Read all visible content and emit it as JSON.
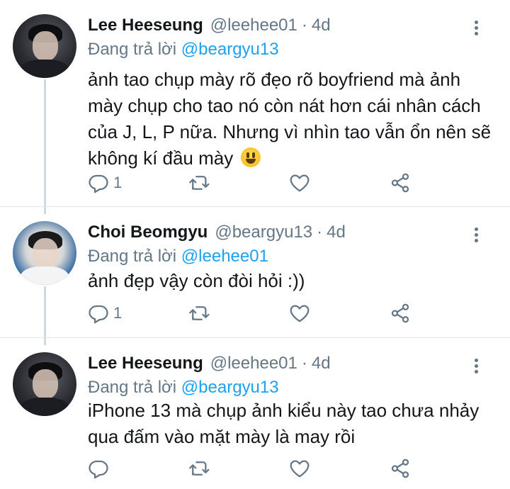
{
  "tweets": [
    {
      "name": "Lee Heeseung",
      "handle": "@leehee01",
      "separator": "·",
      "time": "4d",
      "reply_prefix": "Đang trả lời ",
      "reply_to": "@beargyu13",
      "text": "ảnh tao chụp mày rõ đẹo rõ boyfriend mà ảnh mày chụp cho tao nó còn nát hơn cái nhân cách của J, L, P nữa. Nhưng vì nhìn tao vẫn ổn nên sẽ không kí đầu mày",
      "emoji": "grinning-face-icon",
      "reply_count": "1"
    },
    {
      "name": "Choi Beomgyu",
      "handle": "@beargyu13",
      "separator": "·",
      "time": "4d",
      "reply_prefix": "Đang trả lời ",
      "reply_to": "@leehee01",
      "text": "ảnh đẹp vậy còn đòi hỏi :))",
      "reply_count": "1"
    },
    {
      "name": "Lee Heeseung",
      "handle": "@leehee01",
      "separator": "·",
      "time": "4d",
      "reply_prefix": "Đang trả lời ",
      "reply_to": "@beargyu13",
      "text": "iPhone 13 mà chụp ảnh kiểu này tao chưa nhảy qua đấm vào mặt mày là may rồi",
      "reply_count": ""
    }
  ],
  "icons": {
    "reply": "reply-icon",
    "retweet": "retweet-icon",
    "like": "heart-icon",
    "share": "share-icon",
    "more": "more-vertical-icon"
  },
  "colors": {
    "link": "#1da1f2",
    "muted": "#657786",
    "text": "#14171a",
    "divider": "#e1e8ed"
  }
}
